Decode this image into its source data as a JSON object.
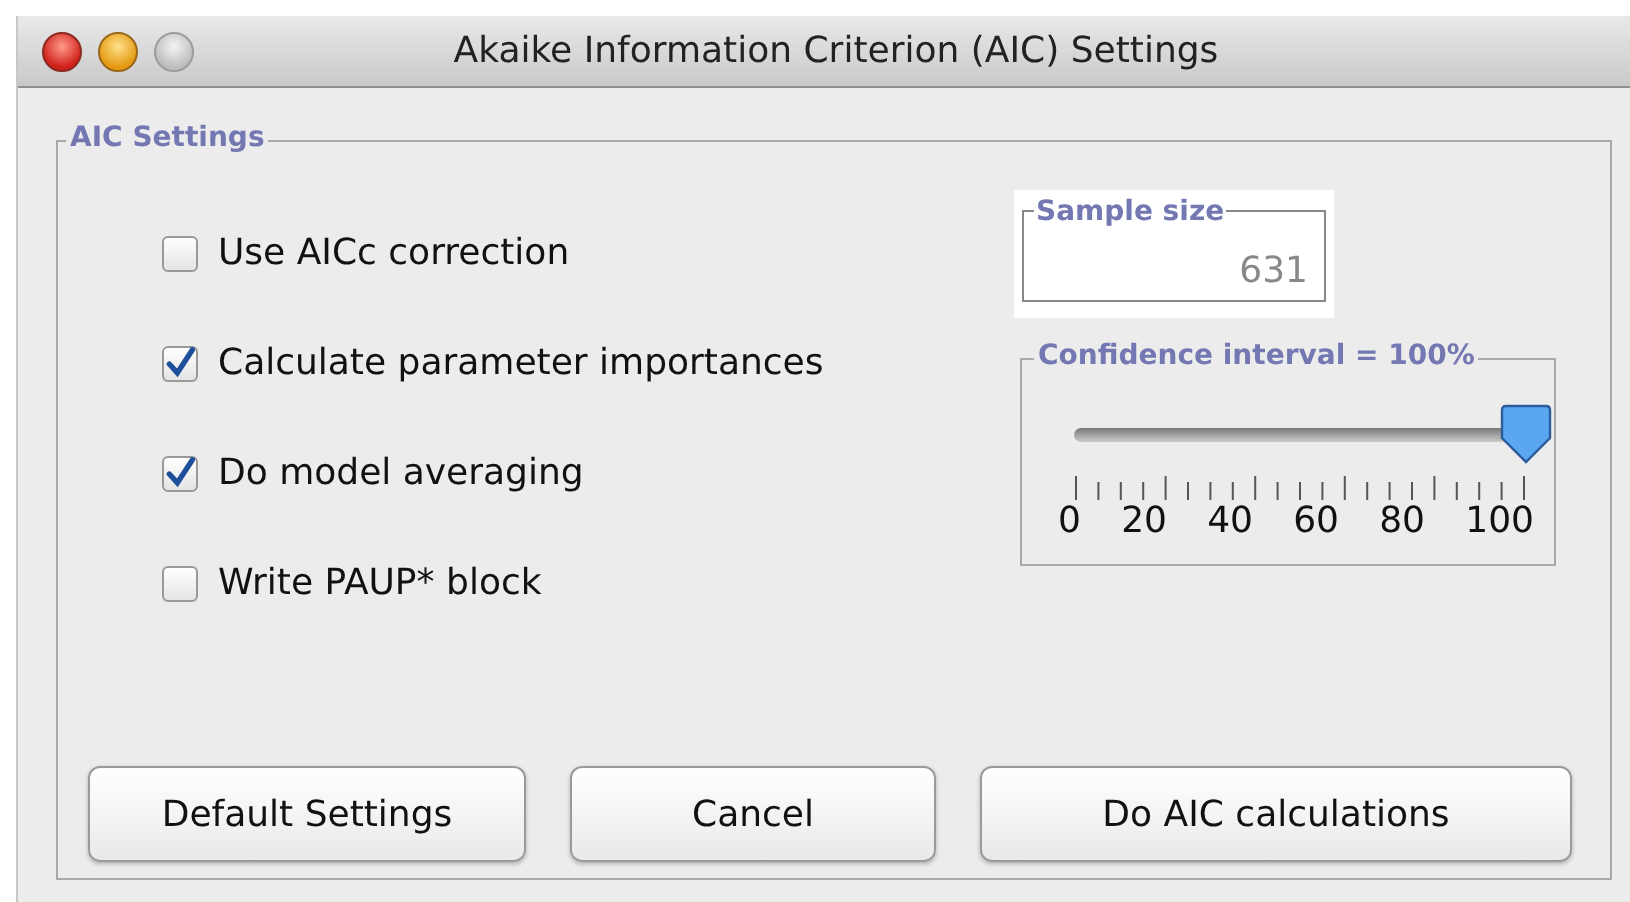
{
  "window": {
    "title": "Akaike Information Criterion (AIC) Settings"
  },
  "group": {
    "title": "AIC Settings"
  },
  "checkboxes": [
    {
      "label": "Use AICc correction",
      "checked": false
    },
    {
      "label": "Calculate parameter importances",
      "checked": true
    },
    {
      "label": "Do model averaging",
      "checked": true
    },
    {
      "label": "Write PAUP* block",
      "checked": false
    }
  ],
  "sample_size": {
    "title": "Sample size",
    "value": "631",
    "disabled": true
  },
  "confidence": {
    "title": "Confidence interval = 100%",
    "level": 1,
    "tick_labels": [
      "0",
      "20",
      "40",
      "60",
      "80",
      "100"
    ]
  },
  "buttons": [
    "Default Settings",
    "Cancel",
    "Do AIC calculations"
  ]
}
